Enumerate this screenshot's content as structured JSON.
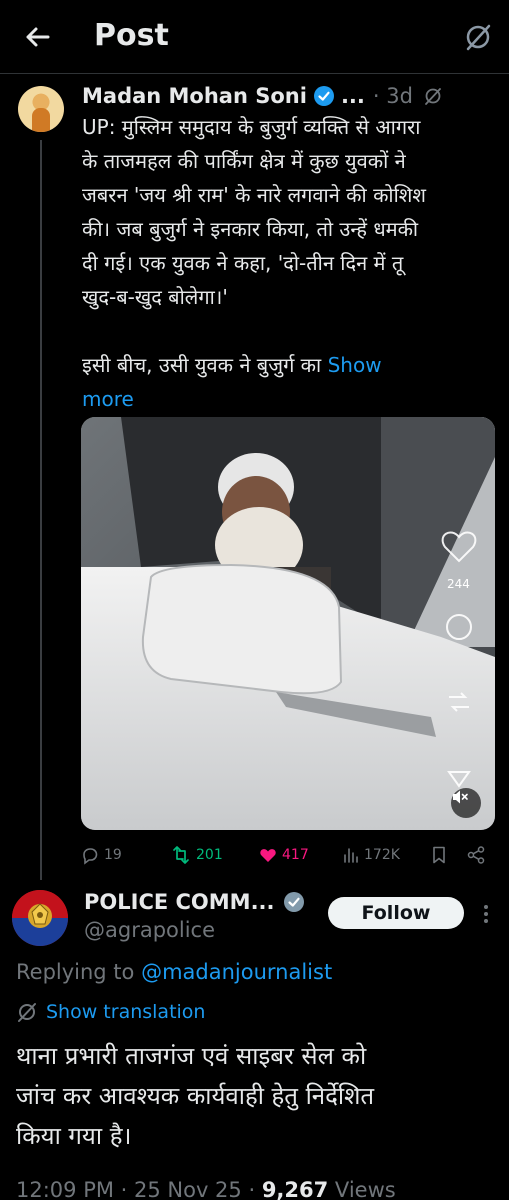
{
  "header": {
    "title": "Post",
    "back_icon": "arrow-left-icon",
    "grok_icon": "grok-icon"
  },
  "original_post": {
    "author_name": "Madan Mohan Soni",
    "verified_icon": "verified-badge-icon",
    "ellipsis": "...",
    "time": "· 3d",
    "text_lines": [
      "UP: मुस्लिम समुदाय के बुजुर्ग व्यक्ति से आगरा",
      "के ताजमहल की पार्किंग क्षेत्र में कुछ युवकों ने",
      "जबरन 'जय श्री राम' के नारे लगवाने की कोशिश",
      "की। जब बुजुर्ग ने इनकार किया, तो उन्हें धमकी",
      "दी गई। एक युवक ने कहा, 'दो-तीन दिन में तू",
      "खुद-ब-खुद बोलेगा।'"
    ],
    "text_line_7": "इसी बीच, उसी युवक ने बुजुर्ग का ",
    "show_more_1": "Show",
    "show_more_2": "more",
    "media": {
      "like_count_overlay": "244",
      "mute_icon": "speaker-muted-icon"
    },
    "actions": {
      "replies": "19",
      "reposts": "201",
      "likes": "417",
      "views": "172K"
    }
  },
  "reply_post": {
    "author_name": "POLICE COMM...",
    "handle": "@agrapolice",
    "follow_label": "Follow",
    "replying_prefix": "Replying to ",
    "replying_mention": "@madanjournalist",
    "show_translation": "Show translation",
    "text_lines": [
      "थाना प्रभारी ताजगंज एवं साइबर सेल को",
      "जांच कर आवश्यक कार्यवाही हेतु निर्देशित",
      "किया गया है।"
    ],
    "time": "12:09 PM · 25 Nov 25 · ",
    "views": "9,267",
    "views_label": " Views"
  },
  "colors": {
    "background": "#000000",
    "text": "#e7e9ea",
    "muted": "#71767b",
    "link": "#1d9bf0",
    "repost": "#00ba7c",
    "like": "#f91880",
    "verified": "#1d9bf0"
  }
}
